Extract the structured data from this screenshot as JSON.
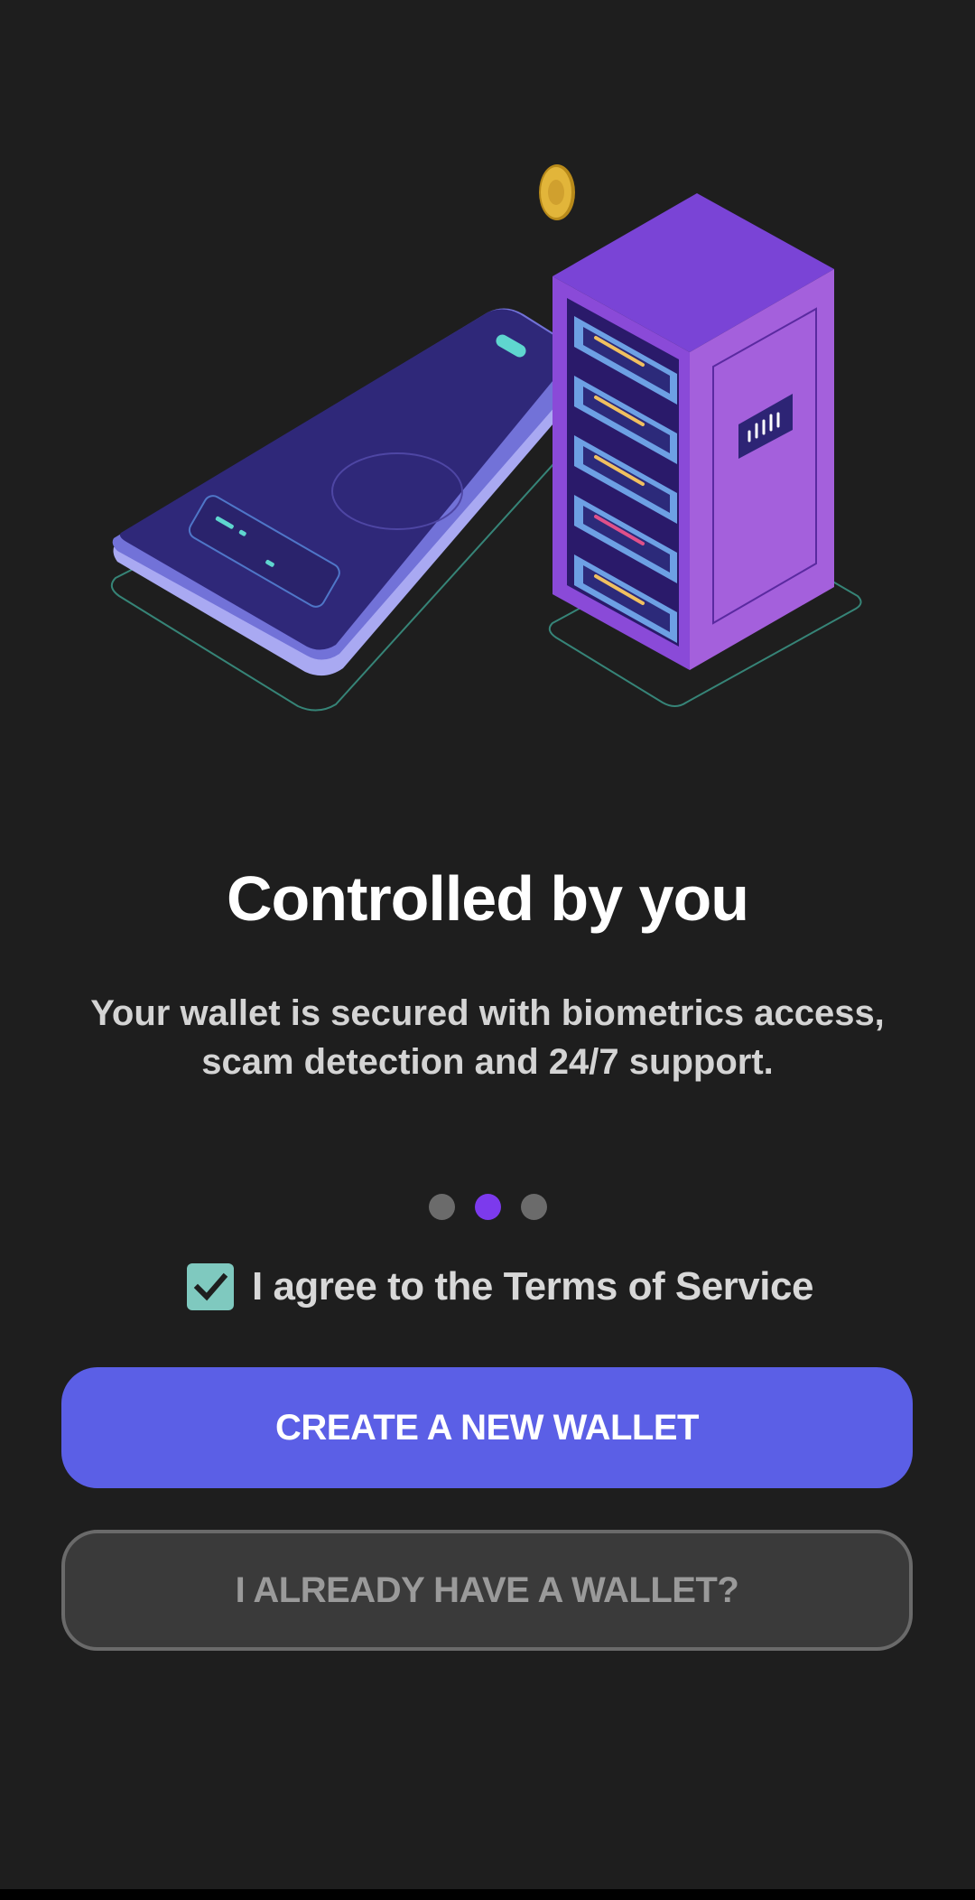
{
  "onboarding": {
    "title": "Controlled by you",
    "subtitle_line1": "Your wallet is secured with biometrics access,",
    "subtitle_line2": "scam detection and 24/7 support.",
    "pager": {
      "count": 3,
      "active_index": 1
    },
    "terms": {
      "checked": true,
      "label": "I agree to the Terms of Service"
    },
    "create_button_label": "CREATE A NEW WALLET",
    "existing_button_label": "I ALREADY HAVE A WALLET?"
  },
  "colors": {
    "background": "#1e1e1e",
    "primary": "#5b5fe6",
    "active_dot": "#7c3aed",
    "inactive_dot": "#6b6b6b",
    "checkbox": "#7fc9bf"
  },
  "illustration": {
    "icons": [
      "phone-icon",
      "server-rack-icon",
      "coin-icon"
    ]
  }
}
